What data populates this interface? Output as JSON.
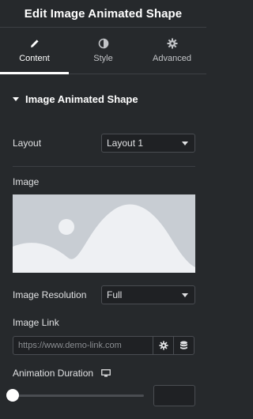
{
  "header": {
    "title": "Edit Image Animated Shape"
  },
  "tabs": [
    {
      "label": "Content",
      "icon": "pencil-icon",
      "active": true
    },
    {
      "label": "Style",
      "icon": "half-circle-icon",
      "active": false
    },
    {
      "label": "Advanced",
      "icon": "gear-icon",
      "active": false
    }
  ],
  "section": {
    "title": "Image Animated Shape"
  },
  "layout": {
    "label": "Layout",
    "value": "Layout 1"
  },
  "image": {
    "label": "Image"
  },
  "resolution": {
    "label": "Image Resolution",
    "value": "Full"
  },
  "link": {
    "label": "Image Link",
    "placeholder": "https://www.demo-link.com"
  },
  "duration": {
    "label": "Animation Duration",
    "value": ""
  },
  "colors": {
    "background": "#26292c",
    "field": "#1f2124",
    "border": "#4a4d52",
    "placeholder_image": "#c8cdd3"
  }
}
